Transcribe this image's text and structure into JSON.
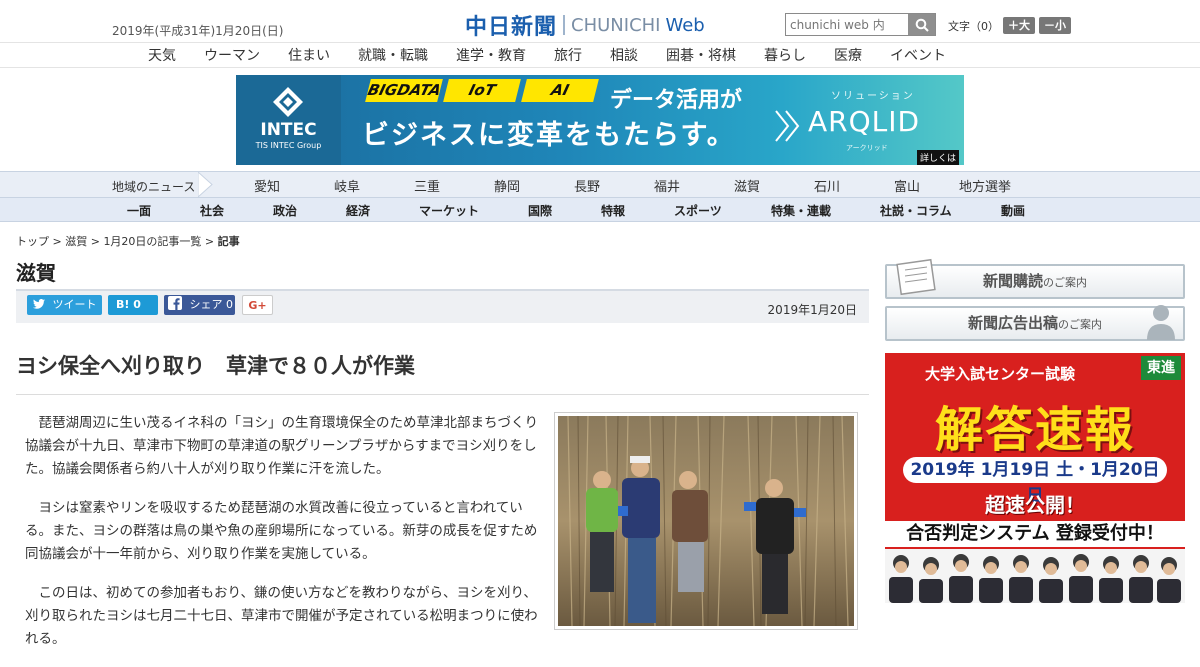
{
  "header": {
    "date": "2019年(平成31年)1月20日(日)",
    "logo_kanji": "中日新聞",
    "logo_en": "CHUNICHI",
    "logo_web": "Web",
    "search_placeholder": "chunichi web 内",
    "font_size_label": "文字（0）",
    "font_bigger": "＋大",
    "font_smaller": "－小"
  },
  "categories": [
    "天気",
    "ウーマン",
    "住まい",
    "就職・転職",
    "進学・教育",
    "旅行",
    "相談",
    "囲碁・将棋",
    "暮らし",
    "医療",
    "イベント"
  ],
  "banner": {
    "company": "INTEC",
    "company_sub": "TIS INTEC Group",
    "tags": [
      "BIGDATA",
      "IoT",
      "AI"
    ],
    "line1": "データ活用が",
    "line2": "ビジネスに変革をもたらす。",
    "solution_label": "ソリューション",
    "product": "ARQLID",
    "product_kana": "アークリッド",
    "details": "詳しくは"
  },
  "region_nav": {
    "label": "地域のニュース",
    "items": [
      "愛知",
      "岐阜",
      "三重",
      "静岡",
      "長野",
      "福井",
      "滋賀",
      "石川",
      "富山",
      "地方選挙"
    ]
  },
  "genre_nav": [
    "一面",
    "社会",
    "政治",
    "経済",
    "マーケット",
    "国際",
    "特報",
    "スポーツ",
    "特集・連載",
    "社説・コラム",
    "動画"
  ],
  "breadcrumb": {
    "top": "トップ",
    "region": "滋賀",
    "list": "1月20日の記事一覧",
    "current": "記事",
    "sep": " > "
  },
  "section_title": "滋賀",
  "share": {
    "tweet": "ツイート",
    "hatena": "B! 0",
    "facebook": "シェア 0",
    "gplus": "G+"
  },
  "article": {
    "date": "2019年1月20日",
    "headline": "ヨシ保全へ刈り取り　草津で８０人が作業",
    "paragraphs": [
      "琵琶湖周辺に生い茂るイネ科の「ヨシ」の生育環境保全のため草津北部まちづくり協議会が十九日、草津市下物町の草津道の駅グリーンプラザからすまでヨシ刈りをした。協議会関係者ら約八十人が刈り取り作業に汗を流した。",
      "ヨシは窒素やリンを吸収するため琵琶湖の水質改善に役立っていると言われている。また、ヨシの群落は鳥の巣や魚の産卵場所になっている。新芽の成長を促すため同協議会が十一年前から、刈り取り作業を実施している。",
      "この日は、初めての参加者もおり、鎌の使い方などを教わりながら、ヨシを刈り、刈り取られたヨシは七月二十七日、草津市で開催が予定されている松明まつりに使われる。"
    ]
  },
  "sidebar": {
    "subscribe": "新聞購読",
    "subscribe_suffix": "のご案内",
    "advertise": "新聞広告出稿",
    "advertise_suffix": "のご案内"
  },
  "ad2": {
    "top": "大学入試センター試験",
    "logo": "東進",
    "big": "解答速報",
    "dates": "2019年 1月19日 土・1月20日 日",
    "fast": "超速公開！",
    "system": "合否判定システム 登録受付中！"
  },
  "colors": {
    "brand_blue": "#1b5fae",
    "region_nav_bg": "#e9eef6",
    "twitter": "#2c9fdc",
    "facebook": "#3b5898",
    "ad_red": "#d8201e",
    "ad_yellow": "#ffdf1a"
  }
}
